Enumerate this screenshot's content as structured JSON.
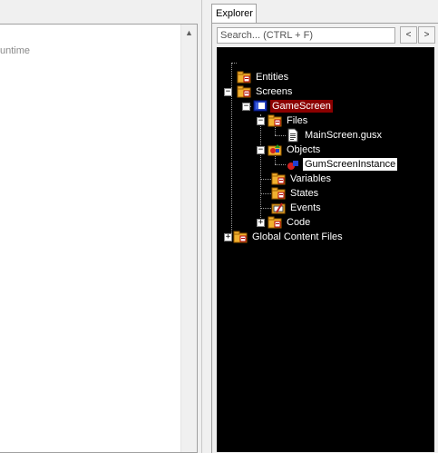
{
  "left_panel": {
    "partial_text": "untime"
  },
  "explorer": {
    "tab_label": "Explorer",
    "search": {
      "placeholder": "Search... (CTRL + F)",
      "value": ""
    },
    "nav": {
      "back": "<",
      "forward": ">"
    },
    "colors": {
      "tree_background": "#000000",
      "selected_primary": "#8b0000",
      "selected_secondary": "#ffffff"
    },
    "tree": {
      "entities": "Entities",
      "screens": "Screens",
      "game_screen": "GameScreen",
      "files": "Files",
      "main_screen_file": "MainScreen.gusx",
      "objects": "Objects",
      "gum_instance": "GumScreenInstance",
      "variables": "Variables",
      "states": "States",
      "events": "Events",
      "code": "Code",
      "global_content": "Global Content Files"
    },
    "icons": {
      "entities": "folder-icon",
      "screens": "folder-icon",
      "game_screen": "screen-icon",
      "files": "folder-icon",
      "main_screen_file": "document-icon",
      "objects": "objects-icon",
      "gum_instance": "object-instance-icon",
      "variables": "folder-icon",
      "states": "folder-icon",
      "events": "events-icon",
      "code": "folder-icon",
      "global_content": "folder-icon"
    }
  }
}
